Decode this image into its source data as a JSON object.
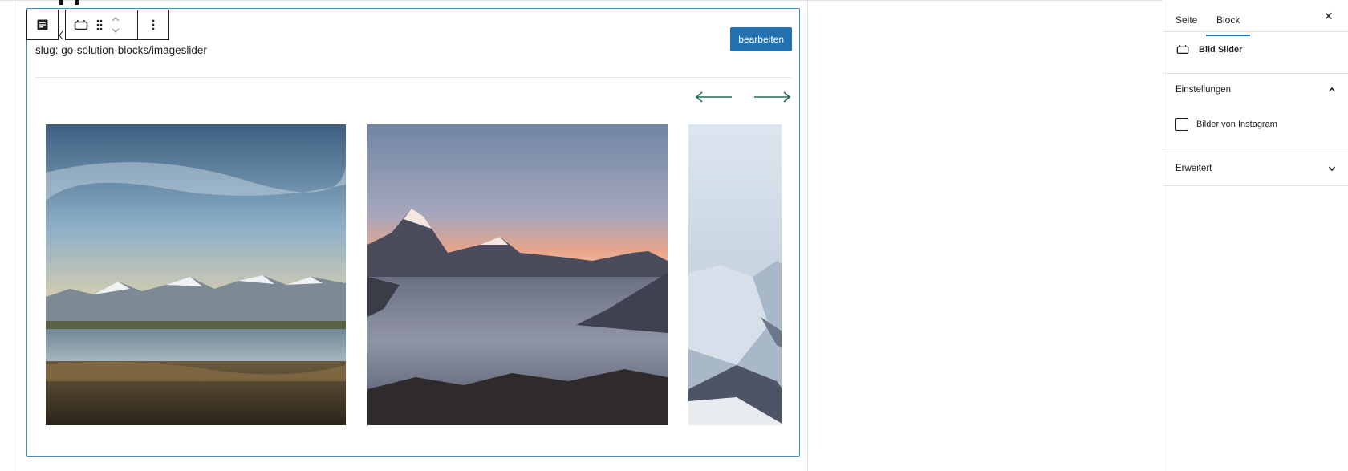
{
  "block": {
    "slug_text": "slug: go-solution-blocks/imageslider",
    "edit_button": "bearbeiten"
  },
  "slider": {
    "prev_icon": "arrow-left-icon",
    "next_icon": "arrow-right-icon",
    "slides": [
      {
        "name": "mountain-lake-landscape"
      },
      {
        "name": "mountains-above-clouds-sunset"
      },
      {
        "name": "snowy-mountain-valley"
      }
    ]
  },
  "toolbar": {
    "icons": [
      "paragraph-icon",
      "slider-block-icon",
      "drag-handle-icon",
      "move-up-down-icon",
      "more-options-icon"
    ]
  },
  "sidebar": {
    "tabs": [
      "Seite",
      "Block"
    ],
    "active_tab": "Block",
    "close_icon": "✕",
    "block_card": {
      "icon": "slider-block-icon",
      "name": "Bild Slider"
    },
    "panels": {
      "settings": {
        "title": "Einstellungen",
        "expanded": true,
        "checkbox": {
          "label": "Bilder von Instagram",
          "checked": false
        }
      },
      "advanced": {
        "title": "Erweitert",
        "expanded": false
      }
    }
  },
  "colors": {
    "accent": "#2271b1",
    "block_border": "#3a8fc0",
    "arrow": "#1f6b58"
  }
}
